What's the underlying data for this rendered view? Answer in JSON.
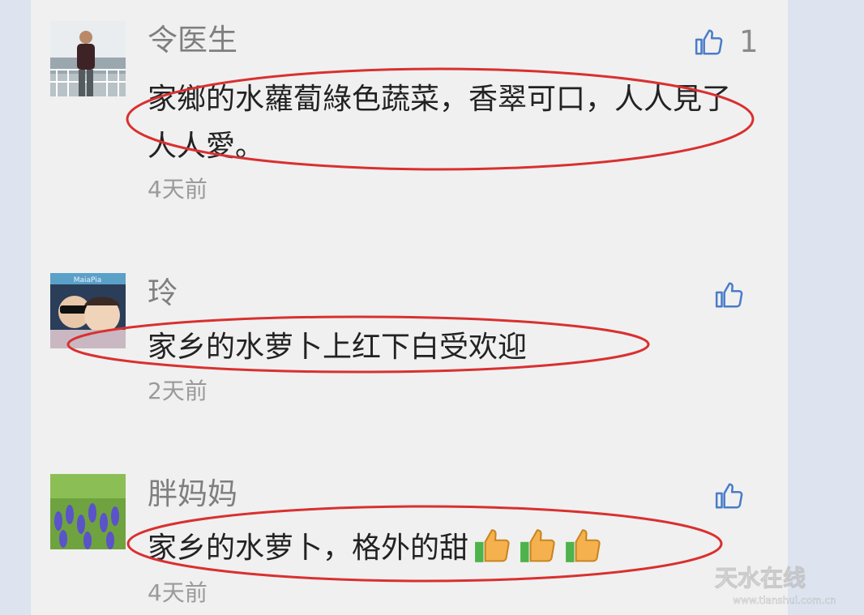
{
  "comments": [
    {
      "name": "令医生",
      "text": "家鄉的水蘿蔔綠色蔬菜，香翠可口，人人見了人人愛。",
      "time": "4天前",
      "likes": "1",
      "avatar_icon": "person-by-railing-avatar"
    },
    {
      "name": "玲",
      "text": "家乡的水萝卜上红下白受欢迎",
      "time": "2天前",
      "likes": "",
      "avatar_icon": "two-kids-selfie-avatar",
      "avatar_text": "MaiaPia"
    },
    {
      "name": "胖妈妈",
      "text": "家乡的水萝卜，格外的甜",
      "time": "4天前",
      "likes": "",
      "avatar_icon": "purple-flowers-avatar",
      "emoji_icons": [
        "thumbs-up-emoji",
        "thumbs-up-emoji",
        "thumbs-up-emoji"
      ]
    }
  ],
  "watermark": {
    "brand": "天水在线",
    "url": "www.tianshui.com.cn"
  },
  "colors": {
    "panel_bg": "#f0f0f0",
    "outer_bg": "#dde4f0",
    "like_icon": "#4a7cc9",
    "annotation_circle": "#d93030",
    "name_text": "#7f7f7f",
    "body_text": "#222222",
    "time_text": "#9a9a9a"
  }
}
